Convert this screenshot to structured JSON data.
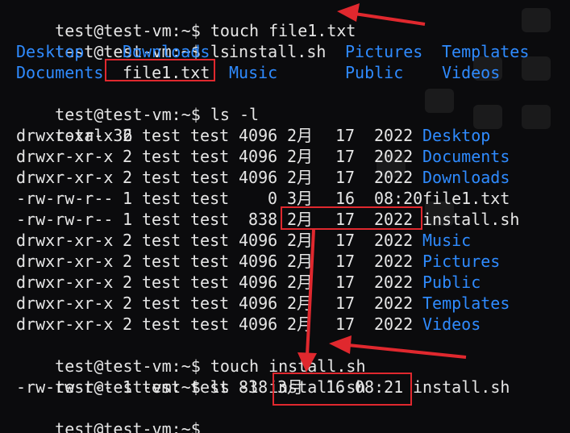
{
  "terminal": {
    "prompt": "test@test-vm:~$",
    "commands": {
      "touch_file1": "touch file1.txt",
      "ls": "ls",
      "ls_l": "ls -l",
      "touch_install": "touch install.sh",
      "ls_l_install": "ls -l install.sh"
    },
    "ls_output": [
      [
        "Desktop",
        "Downloads",
        "install.sh",
        "Pictures",
        "Templates"
      ],
      [
        "Documents",
        "file1.txt",
        "Music",
        "Public",
        "Videos"
      ]
    ],
    "ls_l_total": "total 36",
    "ls_l_rows": [
      {
        "perm": "drwxr-xr-x",
        "links": "2",
        "owner": "test",
        "group": "test",
        "size": "4096",
        "month": "2月",
        "day": "17",
        "time": "2022",
        "name": "Desktop",
        "kind": "dir"
      },
      {
        "perm": "drwxr-xr-x",
        "links": "2",
        "owner": "test",
        "group": "test",
        "size": "4096",
        "month": "2月",
        "day": "17",
        "time": "2022",
        "name": "Documents",
        "kind": "dir"
      },
      {
        "perm": "drwxr-xr-x",
        "links": "2",
        "owner": "test",
        "group": "test",
        "size": "4096",
        "month": "2月",
        "day": "17",
        "time": "2022",
        "name": "Downloads",
        "kind": "dir"
      },
      {
        "perm": "-rw-rw-r--",
        "links": "1",
        "owner": "test",
        "group": "test",
        "size": "0",
        "month": "3月",
        "day": "16",
        "time": "08:20",
        "name": "file1.txt",
        "kind": "file"
      },
      {
        "perm": "-rw-rw-r--",
        "links": "1",
        "owner": "test",
        "group": "test",
        "size": "838",
        "month": "2月",
        "day": "17",
        "time": "2022",
        "name": "install.sh",
        "kind": "file"
      },
      {
        "perm": "drwxr-xr-x",
        "links": "2",
        "owner": "test",
        "group": "test",
        "size": "4096",
        "month": "2月",
        "day": "17",
        "time": "2022",
        "name": "Music",
        "kind": "dir"
      },
      {
        "perm": "drwxr-xr-x",
        "links": "2",
        "owner": "test",
        "group": "test",
        "size": "4096",
        "month": "2月",
        "day": "17",
        "time": "2022",
        "name": "Pictures",
        "kind": "dir"
      },
      {
        "perm": "drwxr-xr-x",
        "links": "2",
        "owner": "test",
        "group": "test",
        "size": "4096",
        "month": "2月",
        "day": "17",
        "time": "2022",
        "name": "Public",
        "kind": "dir"
      },
      {
        "perm": "drwxr-xr-x",
        "links": "2",
        "owner": "test",
        "group": "test",
        "size": "4096",
        "month": "2月",
        "day": "17",
        "time": "2022",
        "name": "Templates",
        "kind": "dir"
      },
      {
        "perm": "drwxr-xr-x",
        "links": "2",
        "owner": "test",
        "group": "test",
        "size": "4096",
        "month": "2月",
        "day": "17",
        "time": "2022",
        "name": "Videos",
        "kind": "dir"
      }
    ],
    "ls_l_install_row": {
      "perm": "-rw-rw-r--",
      "links": "1",
      "owner": "test",
      "group": "test",
      "size": "838",
      "month": "3月",
      "day": "16",
      "time": "08:21",
      "name": "install.sh"
    }
  },
  "colors": {
    "background": "#0b0b0d",
    "text": "#e6e6e6",
    "directory": "#2f8bff",
    "annotation": "#e0282e"
  }
}
